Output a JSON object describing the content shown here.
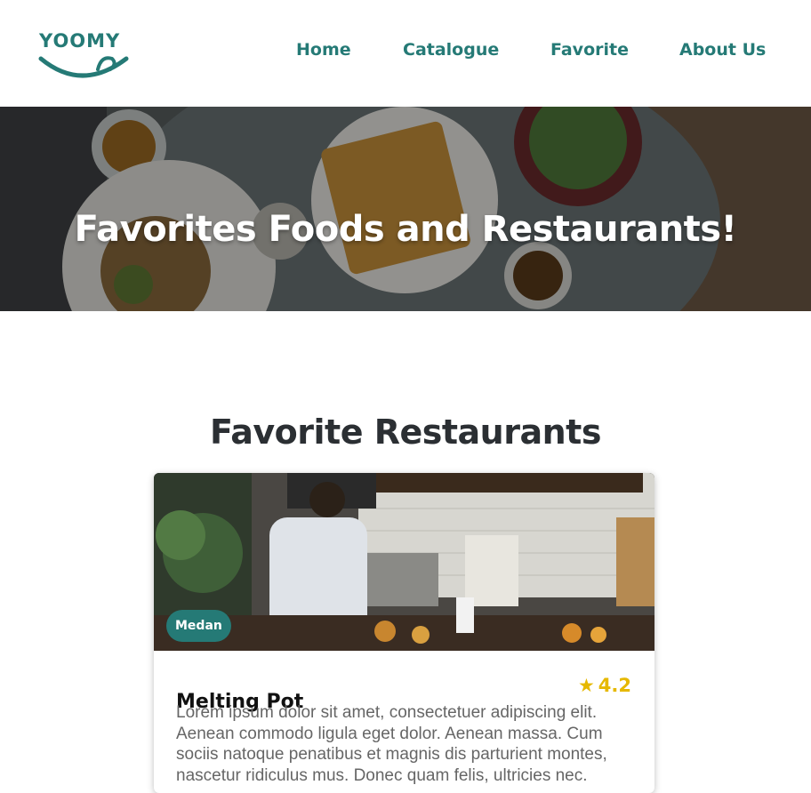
{
  "brand": {
    "logo_text": "YOOMY",
    "color": "#257a76"
  },
  "nav": {
    "items": [
      {
        "label": "Home"
      },
      {
        "label": "Catalogue"
      },
      {
        "label": "Favorite"
      },
      {
        "label": "About Us"
      }
    ]
  },
  "hero": {
    "title": "Favorites Foods and Restaurants!"
  },
  "main": {
    "section_title": "Favorite Restaurants",
    "restaurants": [
      {
        "city": "Medan",
        "name": "Melting Pot",
        "rating": "4.2",
        "rating_icon": "star-icon",
        "description": "Lorem ipsum dolor sit amet, consectetuer adipiscing elit. Aenean commodo ligula eget dolor. Aenean massa. Cum sociis natoque penatibus et magnis dis parturient montes, nascetur ridiculus mus. Donec quam felis, ultricies nec."
      }
    ]
  },
  "colors": {
    "accent": "#257a76",
    "rating": "#e6b800",
    "heading": "#2b2f33"
  }
}
